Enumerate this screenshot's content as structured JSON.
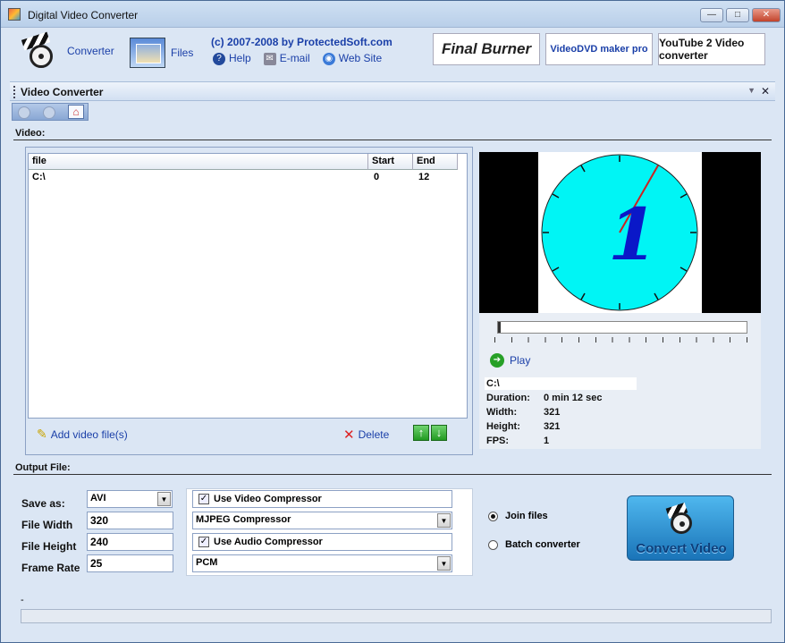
{
  "window": {
    "title": "Digital Video Converter",
    "min": "—",
    "max": "□",
    "close": "✕"
  },
  "toolbar": {
    "converter_label": "Converter",
    "files_label": "Files",
    "copyright": "(c) 2007-2008 by ProtectedSoft.com",
    "help": "Help",
    "email": "E-mail",
    "website": "Web Site",
    "ads": [
      "Final Burner",
      "VideoDVD maker pro",
      "YouTube 2 Video converter"
    ]
  },
  "panel": {
    "title": "Video Converter"
  },
  "video_section": {
    "title": "Video:",
    "columns": [
      "file",
      "Start",
      "End"
    ],
    "rows": [
      {
        "file": "C:\\",
        "start": "0",
        "end": "12"
      }
    ],
    "add_label": "Add video file(s)",
    "delete_label": "Delete"
  },
  "preview": {
    "play_label": "Play",
    "path": "C:\\",
    "info": [
      {
        "label": "Duration:",
        "value": "0 min 12 sec"
      },
      {
        "label": "Width:",
        "value": "321"
      },
      {
        "label": "Height:",
        "value": "321"
      },
      {
        "label": "FPS:",
        "value": "1"
      }
    ],
    "clock_digit": "1",
    "colors": {
      "face": "#00f5f5",
      "hand": "#cc2222",
      "digit": "#0a18c8"
    }
  },
  "output": {
    "title": "Output File:",
    "save_as_label": "Save as:",
    "save_as_value": "AVI",
    "width_label": "File Width",
    "width_value": "320",
    "height_label": "File Height",
    "height_value": "240",
    "rate_label": "Frame Rate",
    "rate_value": "25",
    "use_video_label": "Use Video Compressor",
    "video_compressor": "MJPEG Compressor",
    "use_audio_label": "Use Audio Compressor",
    "audio_compressor": "PCM",
    "join_label": "Join files",
    "batch_label": "Batch converter",
    "convert_label": "Convert Video",
    "status_text": "-"
  }
}
